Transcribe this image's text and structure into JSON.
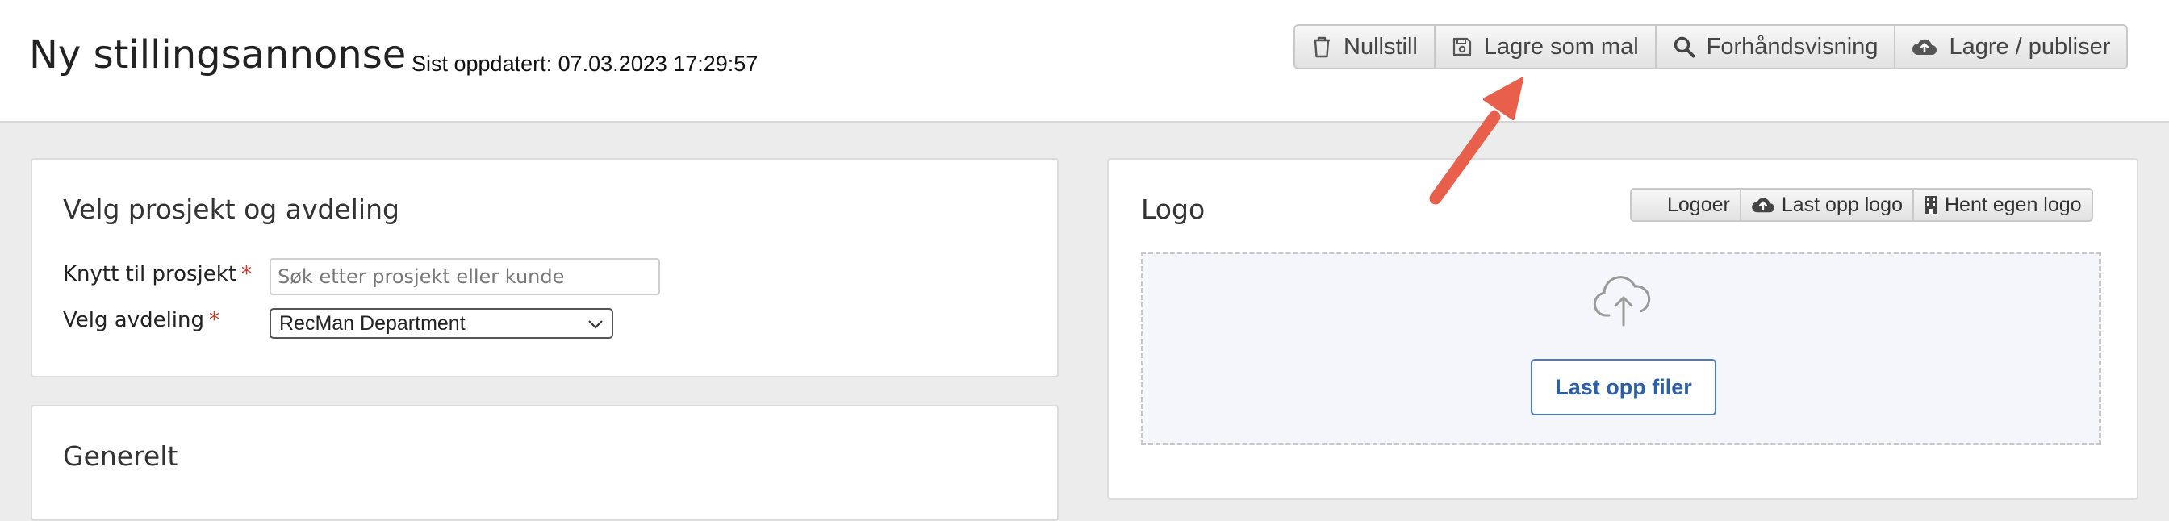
{
  "header": {
    "title": "Ny stillingsannonse",
    "last_updated": "Sist oppdatert: 07.03.2023 17:29:57",
    "actions": {
      "reset": "Nullstill",
      "save_template": "Lagre som mal",
      "preview": "Forhåndsvisning",
      "save_publish": "Lagre / publiser"
    }
  },
  "project_panel": {
    "title": "Velg prosjekt og avdeling",
    "project_label": "Knytt til prosjekt",
    "project_placeholder": "Søk etter prosjekt eller kunde",
    "department_label": "Velg avdeling",
    "department_value": "RecMan Department",
    "required_mark": "*"
  },
  "general_panel": {
    "title": "Generelt"
  },
  "logo_panel": {
    "title": "Logo",
    "actions": {
      "logos": "Logoer",
      "upload_logo": "Last opp logo",
      "get_own_logo": "Hent egen logo"
    },
    "upload_button": "Last opp filer"
  },
  "annotation": {
    "arrow_color": "#e8604c"
  },
  "colors": {
    "required": "#c0392b",
    "upload_accent": "#2b5fa6"
  }
}
